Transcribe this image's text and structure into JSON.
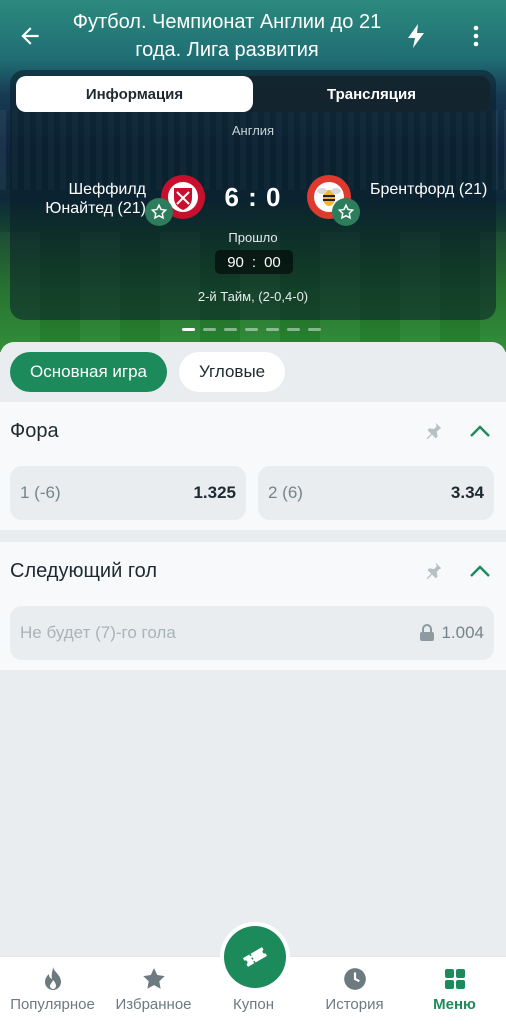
{
  "header": {
    "title": "Футбол. Чемпионат Англии до 21 года. Лига развития"
  },
  "match_card": {
    "tabs": [
      {
        "label": "Информация",
        "active": true
      },
      {
        "label": "Трансляция",
        "active": false
      }
    ],
    "country": "Англия",
    "home_team": "Шеффилд Юнайтед (21)",
    "away_team": "Брентфорд (21)",
    "score": "6 : 0",
    "status": "Прошло",
    "clock_minutes": "90",
    "clock_seconds": "00",
    "period": "2-й Тайм, (2-0,4-0)"
  },
  "pager": {
    "count": 7,
    "active_index": 0
  },
  "filters": [
    {
      "label": "Основная игра",
      "active": true
    },
    {
      "label": "Угловые",
      "active": false
    }
  ],
  "markets": [
    {
      "title": "Фора",
      "outcomes": [
        {
          "label": "1 (-6)",
          "odds": "1.325"
        },
        {
          "label": "2 (6)",
          "odds": "3.34"
        }
      ]
    },
    {
      "title": "Следующий гол",
      "outcomes": [
        {
          "label": "Не будет (7)-го гола",
          "odds": "1.004",
          "locked": true
        }
      ]
    }
  ],
  "bottom_nav": [
    {
      "label": "Популярное",
      "icon": "flame-icon"
    },
    {
      "label": "Избранное",
      "icon": "star-icon"
    },
    {
      "label": "Купон",
      "icon": "ticket-icon"
    },
    {
      "label": "История",
      "icon": "clock-icon"
    },
    {
      "label": "Меню",
      "icon": "grid-icon",
      "active": true
    }
  ],
  "colors": {
    "accent": "#1d8a5c",
    "header_teal": "#2c8a7e",
    "home_crest": "#c8102e",
    "away_crest": "#e03a2f"
  }
}
